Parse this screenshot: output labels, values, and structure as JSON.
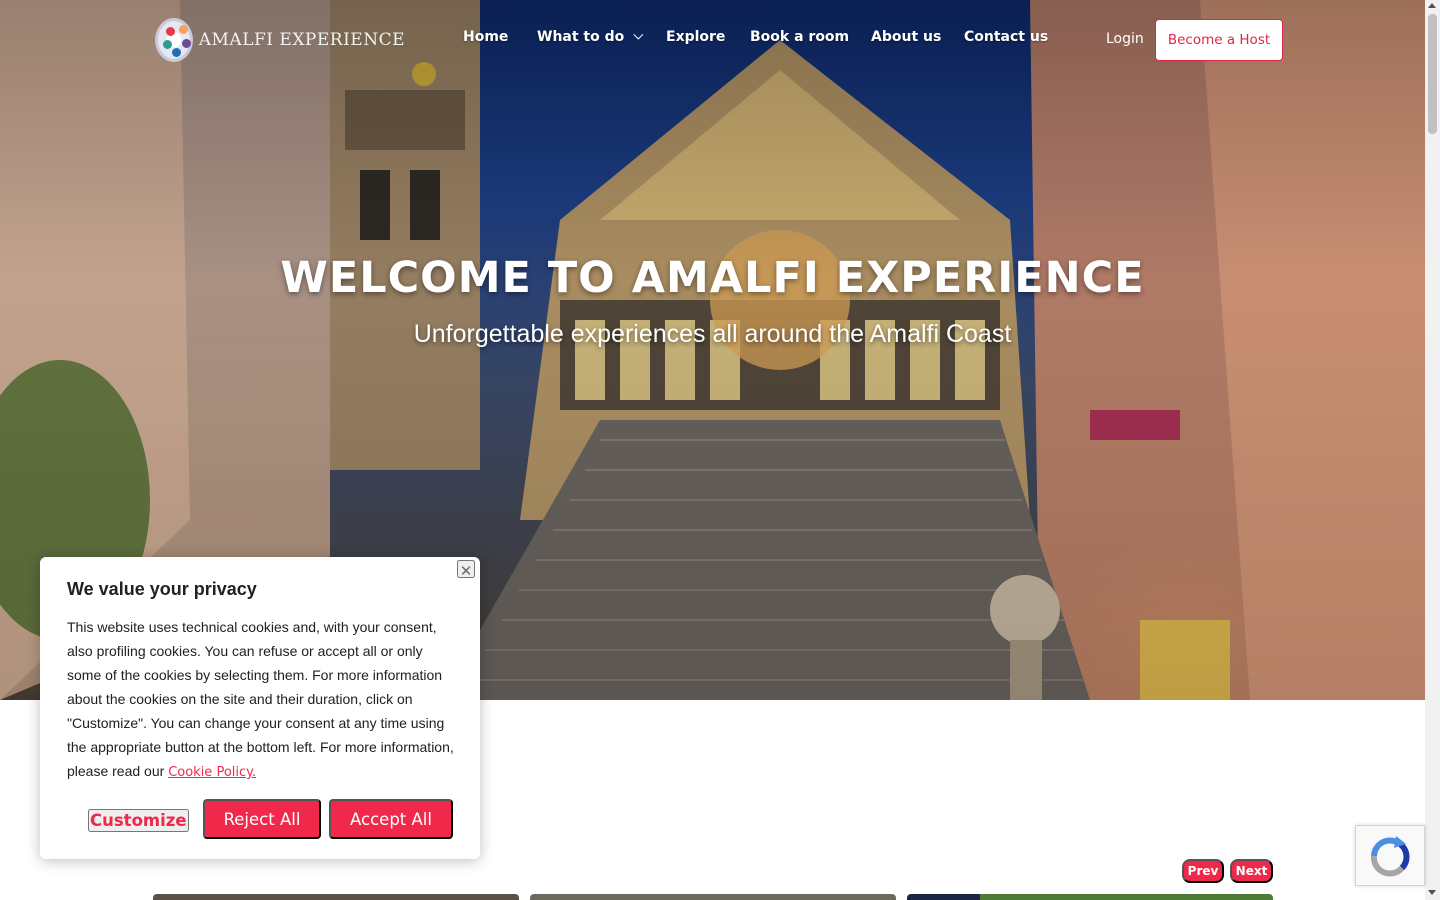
{
  "brand": {
    "name": "AMALFI EXPERIENCE",
    "accent_color": "#f0284a"
  },
  "nav": {
    "items": [
      {
        "label": "Home"
      },
      {
        "label": "What to do",
        "has_dropdown": true
      },
      {
        "label": "Explore"
      },
      {
        "label": "Book a room"
      },
      {
        "label": "About us"
      },
      {
        "label": "Contact us"
      }
    ],
    "login_label": "Login",
    "host_button_label": "Become a Host"
  },
  "hero": {
    "title": "WELCOME TO AMALFI EXPERIENCE",
    "subtitle": "Unforgettable experiences all around the Amalfi Coast"
  },
  "carousel": {
    "prev_label": "Prev",
    "next_label": "Next"
  },
  "cookie_banner": {
    "title": "We value your privacy",
    "body": "This website uses technical cookies and, with your consent, also profiling cookies. You can refuse or accept all or only some of the cookies by selecting them. For more information about the cookies on the site and their duration, click on \"Customize\". You can change your consent at any time using the appropriate button at the bottom left. For more information, please read our ",
    "link_label": "Cookie Policy.",
    "close_icon": "close-icon",
    "customize_label": "Customize",
    "reject_label": "Reject All",
    "accept_label": "Accept All"
  },
  "icons": {
    "logo": "logo-icon",
    "recaptcha": "recaptcha-icon",
    "dropdown": "chevron-down-icon"
  }
}
